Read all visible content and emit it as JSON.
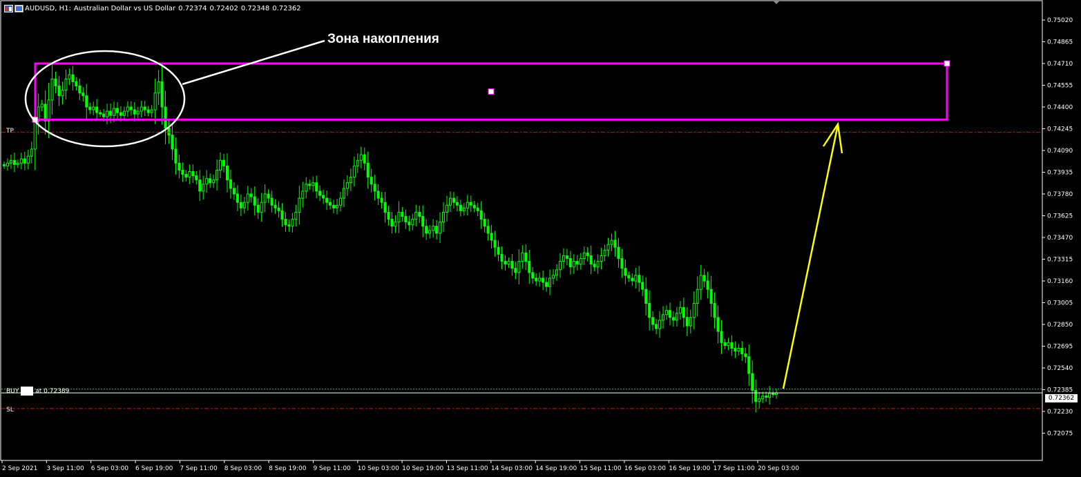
{
  "header": {
    "symbol": "AUDUSD, H1:",
    "description": "Australian Dollar vs US Dollar",
    "open": "0.72374",
    "high": "0.72402",
    "low": "0.72348",
    "close": "0.72362"
  },
  "annotation": {
    "text": "Зона накопления"
  },
  "lines": {
    "tp_label": "TP",
    "sl_label": "SL",
    "buy_label": "BUY",
    "buy_at": "at 0.72389",
    "current_price": "0.72362"
  },
  "colors": {
    "background": "#000000",
    "candle": "#00ff00",
    "zone": "#ff00ff",
    "arrow": "#ffff00",
    "stop_lines": "#ff0000",
    "buy_line": "#32cd32",
    "grid_text": "#ffffff"
  },
  "chart_data": {
    "type": "candlestick",
    "y_ticks": [
      "0.75020",
      "0.74865",
      "0.74710",
      "0.74555",
      "0.74400",
      "0.74245",
      "0.74090",
      "0.73935",
      "0.73780",
      "0.73625",
      "0.73470",
      "0.73315",
      "0.73160",
      "0.73005",
      "0.72850",
      "0.72695",
      "0.72540",
      "0.72385",
      "0.72230",
      "0.72075"
    ],
    "x_ticks": [
      "2 Sep 2021",
      "3 Sep 11:00",
      "6 Sep 03:00",
      "6 Sep 19:00",
      "7 Sep 11:00",
      "8 Sep 03:00",
      "8 Sep 19:00",
      "9 Sep 11:00",
      "10 Sep 03:00",
      "10 Sep 19:00",
      "13 Sep 11:00",
      "14 Sep 03:00",
      "14 Sep 19:00",
      "15 Sep 11:00",
      "16 Sep 03:00",
      "16 Sep 19:00",
      "17 Sep 11:00",
      "20 Sep 03:00"
    ],
    "ylim": [
      0.7199,
      0.751
    ],
    "levels": {
      "tp": 0.7422,
      "sl": 0.7225,
      "buy": 0.72389,
      "current": 0.72362
    },
    "zone": {
      "top": 0.7471,
      "bottom": 0.7431
    },
    "closes": [
      0.7398,
      0.74,
      0.7402,
      0.7399,
      0.74,
      0.7403,
      0.74,
      0.7405,
      0.741,
      0.743,
      0.744,
      0.7442,
      0.743,
      0.7445,
      0.746,
      0.7455,
      0.7448,
      0.7452,
      0.746,
      0.7463,
      0.7458,
      0.7455,
      0.745,
      0.7448,
      0.744,
      0.7438,
      0.744,
      0.7436,
      0.7435,
      0.7433,
      0.7437,
      0.7434,
      0.7439,
      0.7436,
      0.7434,
      0.7437,
      0.744,
      0.7438,
      0.7435,
      0.7437,
      0.744,
      0.7438,
      0.7436,
      0.7438,
      0.745,
      0.7458,
      0.744,
      0.7425,
      0.742,
      0.741,
      0.74,
      0.7395,
      0.7392,
      0.739,
      0.7394,
      0.7391,
      0.7388,
      0.738,
      0.7385,
      0.7389,
      0.7386,
      0.7388,
      0.7395,
      0.7402,
      0.7398,
      0.7388,
      0.7382,
      0.7378,
      0.7372,
      0.7368,
      0.7372,
      0.7378,
      0.7376,
      0.737,
      0.7365,
      0.7372,
      0.7378,
      0.7375,
      0.737,
      0.7368,
      0.7366,
      0.736,
      0.7356,
      0.7355,
      0.736,
      0.7365,
      0.7375,
      0.738,
      0.7385,
      0.7384,
      0.7386,
      0.738,
      0.7377,
      0.7375,
      0.7372,
      0.737,
      0.7368,
      0.737,
      0.7375,
      0.7382,
      0.7386,
      0.739,
      0.7398,
      0.7402,
      0.7406,
      0.74,
      0.739,
      0.7385,
      0.738,
      0.7375,
      0.7372,
      0.7365,
      0.736,
      0.7355,
      0.7358,
      0.7365,
      0.7362,
      0.7358,
      0.7356,
      0.736,
      0.7365,
      0.7362,
      0.7355,
      0.735,
      0.7352,
      0.7355,
      0.735,
      0.7358,
      0.7365,
      0.737,
      0.7375,
      0.7372,
      0.737,
      0.7366,
      0.7368,
      0.7372,
      0.737,
      0.7368,
      0.7366,
      0.736,
      0.7355,
      0.735,
      0.7345,
      0.734,
      0.7335,
      0.733,
      0.7328,
      0.733,
      0.7325,
      0.7322,
      0.733,
      0.7336,
      0.733,
      0.7322,
      0.7318,
      0.7316,
      0.7318,
      0.7315,
      0.7312,
      0.7318,
      0.732,
      0.7324,
      0.733,
      0.7334,
      0.7332,
      0.7326,
      0.733,
      0.7328,
      0.7332,
      0.7336,
      0.7334,
      0.7328,
      0.7326,
      0.733,
      0.7334,
      0.7338,
      0.7342,
      0.7345,
      0.734,
      0.7332,
      0.7325,
      0.732,
      0.7318,
      0.7316,
      0.732,
      0.7315,
      0.731,
      0.73,
      0.729,
      0.7285,
      0.7282,
      0.7288,
      0.7292,
      0.7295,
      0.729,
      0.7288,
      0.7293,
      0.7297,
      0.729,
      0.7284,
      0.729,
      0.73,
      0.731,
      0.732,
      0.7316,
      0.731,
      0.73,
      0.729,
      0.728,
      0.7272,
      0.727,
      0.7272,
      0.7268,
      0.7266,
      0.7268,
      0.7264,
      0.7262,
      0.725,
      0.7238,
      0.723,
      0.7232,
      0.7234,
      0.7233,
      0.7236,
      0.7235,
      0.72362
    ]
  }
}
